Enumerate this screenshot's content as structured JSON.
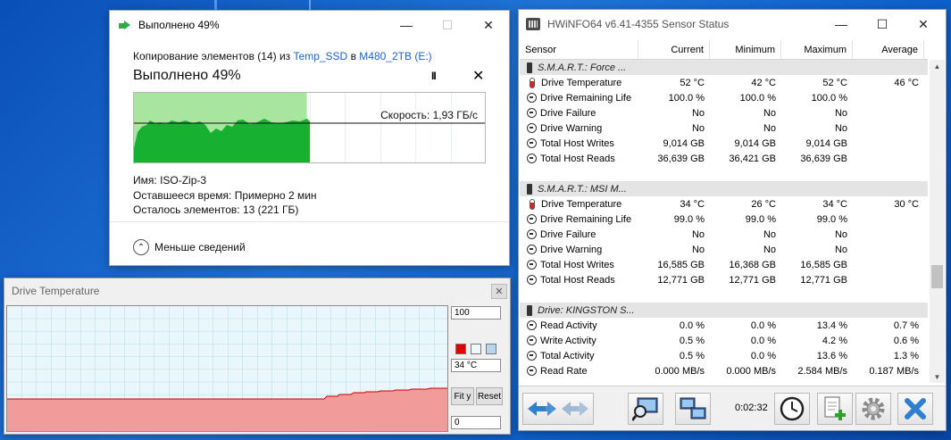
{
  "copy_dialog": {
    "title": "Выполнено 49%",
    "copy_prefix": "Копирование элементов (14) из",
    "source": "Temp_SSD",
    "in_word": "в",
    "destination": "M480_2TB (E:)",
    "progress_heading": "Выполнено 49%",
    "progress_percent": 49,
    "speed_label": "Скорость: 1,93 ГБ/с",
    "name_label": "Имя:",
    "name_value": "ISO-Zip-3",
    "time_label": "Оставшееся время:",
    "time_value": "Примерно 2 мин",
    "items_label": "Осталось элементов:",
    "items_value": "13 (221 ГБ)",
    "less_details": "Меньше сведений",
    "pause_glyph": "II",
    "stop_glyph": "✕",
    "collapse_glyph": "⌃"
  },
  "window_controls": {
    "minimize": "—",
    "maximize": "☐",
    "close": "✕"
  },
  "temp_window": {
    "title": "Drive Temperature",
    "max_value": "100",
    "current_value": "34 °C",
    "min_value": "0",
    "fit_button": "Fit y",
    "reset_button": "Reset",
    "close_glyph": "✕",
    "colors": {
      "line": "#cc0000",
      "fill": "#f29b9b",
      "background": "#e9f7fd",
      "grid": "#b9d7e4"
    }
  },
  "hwinfo": {
    "title": "HWiNFO64 v6.41-4355 Sensor Status",
    "columns": {
      "sensor": "Sensor",
      "current": "Current",
      "minimum": "Minimum",
      "maximum": "Maximum",
      "average": "Average"
    },
    "rows": [
      {
        "type": "group",
        "label": "S.M.A.R.T.: Force ..."
      },
      {
        "type": "data",
        "icon": "thermometer",
        "label": "Drive Temperature",
        "current": "52 °C",
        "minimum": "42 °C",
        "maximum": "52 °C",
        "average": "46 °C"
      },
      {
        "type": "data",
        "icon": "sensor",
        "label": "Drive Remaining Life",
        "current": "100.0 %",
        "minimum": "100.0 %",
        "maximum": "100.0 %",
        "average": ""
      },
      {
        "type": "data",
        "icon": "sensor",
        "label": "Drive Failure",
        "current": "No",
        "minimum": "No",
        "maximum": "No",
        "average": ""
      },
      {
        "type": "data",
        "icon": "sensor",
        "label": "Drive Warning",
        "current": "No",
        "minimum": "No",
        "maximum": "No",
        "average": ""
      },
      {
        "type": "data",
        "icon": "sensor",
        "label": "Total Host Writes",
        "current": "9,014 GB",
        "minimum": "9,014 GB",
        "maximum": "9,014 GB",
        "average": ""
      },
      {
        "type": "data",
        "icon": "sensor",
        "label": "Total Host Reads",
        "current": "36,639 GB",
        "minimum": "36,421 GB",
        "maximum": "36,639 GB",
        "average": ""
      },
      {
        "type": "blank"
      },
      {
        "type": "group",
        "label": "S.M.A.R.T.: MSI M..."
      },
      {
        "type": "data",
        "icon": "thermometer",
        "label": "Drive Temperature",
        "current": "34 °C",
        "minimum": "26 °C",
        "maximum": "34 °C",
        "average": "30 °C"
      },
      {
        "type": "data",
        "icon": "sensor",
        "label": "Drive Remaining Life",
        "current": "99.0 %",
        "minimum": "99.0 %",
        "maximum": "99.0 %",
        "average": ""
      },
      {
        "type": "data",
        "icon": "sensor",
        "label": "Drive Failure",
        "current": "No",
        "minimum": "No",
        "maximum": "No",
        "average": ""
      },
      {
        "type": "data",
        "icon": "sensor",
        "label": "Drive Warning",
        "current": "No",
        "minimum": "No",
        "maximum": "No",
        "average": ""
      },
      {
        "type": "data",
        "icon": "sensor",
        "label": "Total Host Writes",
        "current": "16,585 GB",
        "minimum": "16,368 GB",
        "maximum": "16,585 GB",
        "average": ""
      },
      {
        "type": "data",
        "icon": "sensor",
        "label": "Total Host Reads",
        "current": "12,771 GB",
        "minimum": "12,771 GB",
        "maximum": "12,771 GB",
        "average": ""
      },
      {
        "type": "blank"
      },
      {
        "type": "group",
        "label": "Drive: KINGSTON S..."
      },
      {
        "type": "data",
        "icon": "sensor",
        "label": "Read Activity",
        "current": "0.0 %",
        "minimum": "0.0 %",
        "maximum": "13.4 %",
        "average": "0.7 %"
      },
      {
        "type": "data",
        "icon": "sensor",
        "label": "Write Activity",
        "current": "0.5 %",
        "minimum": "0.0 %",
        "maximum": "4.2 %",
        "average": "0.6 %"
      },
      {
        "type": "data",
        "icon": "sensor",
        "label": "Total Activity",
        "current": "0.5 %",
        "minimum": "0.0 %",
        "maximum": "13.6 %",
        "average": "1.3 %"
      },
      {
        "type": "data",
        "icon": "sensor",
        "label": "Read Rate",
        "current": "0.000 MB/s",
        "minimum": "0.000 MB/s",
        "maximum": "2.584 MB/s",
        "average": "0.187 MB/s"
      }
    ],
    "timer": "0:02:32",
    "scroll_up": "▲",
    "scroll_down": "▼"
  }
}
